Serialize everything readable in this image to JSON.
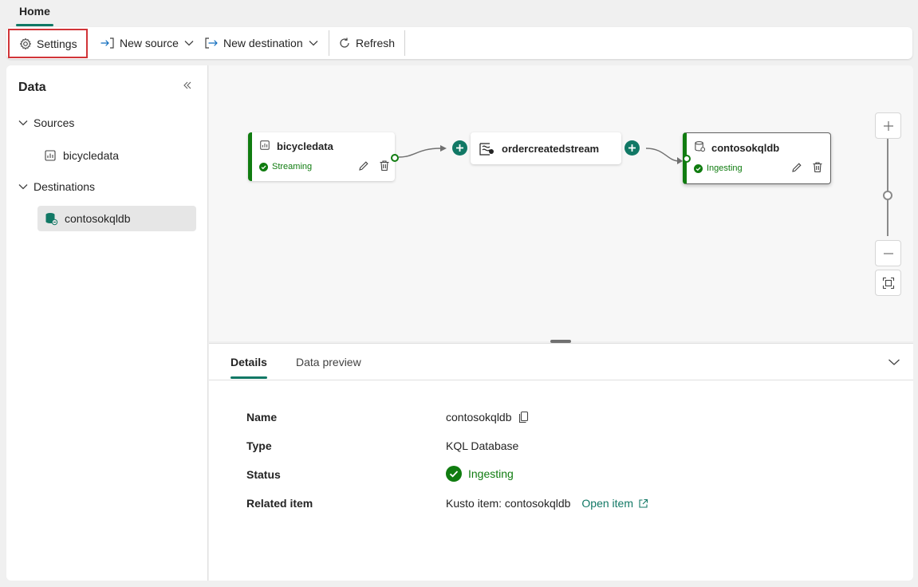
{
  "tabs": {
    "home": "Home"
  },
  "toolbar": {
    "settings": "Settings",
    "new_source": "New source",
    "new_destination": "New destination",
    "refresh": "Refresh"
  },
  "left_panel": {
    "title": "Data",
    "sources_label": "Sources",
    "sources": [
      "bicycledata"
    ],
    "destinations_label": "Destinations",
    "destinations": [
      "contosokqldb"
    ]
  },
  "canvas": {
    "source_node": {
      "title": "bicycledata",
      "status": "Streaming"
    },
    "stream_node": {
      "title": "ordercreatedstream"
    },
    "dest_node": {
      "title": "contosokqldb",
      "status": "Ingesting"
    }
  },
  "details": {
    "tabs": [
      "Details",
      "Data preview"
    ],
    "name_label": "Name",
    "name_value": "contosokqldb",
    "type_label": "Type",
    "type_value": "KQL Database",
    "status_label": "Status",
    "status_value": "Ingesting",
    "related_label": "Related item",
    "related_value": "Kusto item: contosokqldb",
    "open_item": "Open item"
  },
  "colors": {
    "accent": "#117865",
    "status_green": "#107c10",
    "highlight_border": "#d13438"
  }
}
